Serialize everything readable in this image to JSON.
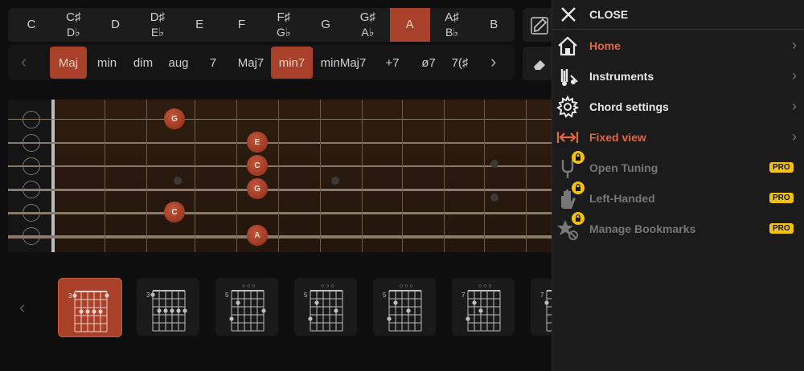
{
  "notes": [
    {
      "label": "C",
      "flat": ""
    },
    {
      "label": "C♯",
      "flat": "D♭"
    },
    {
      "label": "D",
      "flat": ""
    },
    {
      "label": "D♯",
      "flat": "E♭"
    },
    {
      "label": "E",
      "flat": ""
    },
    {
      "label": "F",
      "flat": ""
    },
    {
      "label": "F♯",
      "flat": "G♭"
    },
    {
      "label": "G",
      "flat": ""
    },
    {
      "label": "G♯",
      "flat": "A♭"
    },
    {
      "label": "A",
      "flat": ""
    },
    {
      "label": "A♯",
      "flat": "B♭"
    },
    {
      "label": "B",
      "flat": ""
    }
  ],
  "selected_note": "A",
  "chord_types": [
    "Maj",
    "min",
    "dim",
    "aug",
    "7",
    "Maj7",
    "min7",
    "minMaj7",
    "+7",
    "ø7",
    "7(♯"
  ],
  "selected_types": [
    "Maj",
    "min7"
  ],
  "fretboard": {
    "notes": [
      {
        "string": 1,
        "fret": 3,
        "label": "G"
      },
      {
        "string": 2,
        "fret": 5,
        "label": "E"
      },
      {
        "string": 3,
        "fret": 5,
        "label": "C"
      },
      {
        "string": 4,
        "fret": 5,
        "label": "G"
      },
      {
        "string": 5,
        "fret": 3,
        "label": "C"
      },
      {
        "string": 6,
        "fret": 5,
        "label": "A"
      }
    ]
  },
  "chord_thumbnails": [
    {
      "fret": "3",
      "open": ""
    },
    {
      "fret": "3",
      "open": ""
    },
    {
      "fret": "5",
      "open": "○ ○ ○"
    },
    {
      "fret": "5",
      "open": "○ ○ ○"
    },
    {
      "fret": "5",
      "open": "○ ○ ○"
    },
    {
      "fret": "7",
      "open": "○ ○ ○"
    },
    {
      "fret": "7",
      "open": ""
    }
  ],
  "menu": {
    "close_label": "CLOSE",
    "items": [
      {
        "label": "Home",
        "icon": "home-icon",
        "color": "#e8633e",
        "pro": ""
      },
      {
        "label": "Instruments",
        "icon": "instruments-icon",
        "color": "#e8e8e8",
        "pro": ""
      },
      {
        "label": "Chord settings",
        "icon": "gear-icon",
        "color": "#e8e8e8",
        "pro": ""
      },
      {
        "label": "Fixed view",
        "icon": "fixed-view-icon",
        "color": "#e8633e",
        "pro": ""
      },
      {
        "label": "Open Tuning",
        "icon": "tuning-fork-icon",
        "color": "#777777",
        "pro": "PRO"
      },
      {
        "label": "Left-Handed",
        "icon": "hand-icon",
        "color": "#777777",
        "pro": "PRO"
      },
      {
        "label": "Manage Bookmarks",
        "icon": "bookmark-star-icon",
        "color": "#777777",
        "pro": "PRO"
      }
    ]
  },
  "colors": {
    "accent": "#a8402a",
    "menu_accent": "#e8633e",
    "pro_badge": "#f4c20d"
  }
}
